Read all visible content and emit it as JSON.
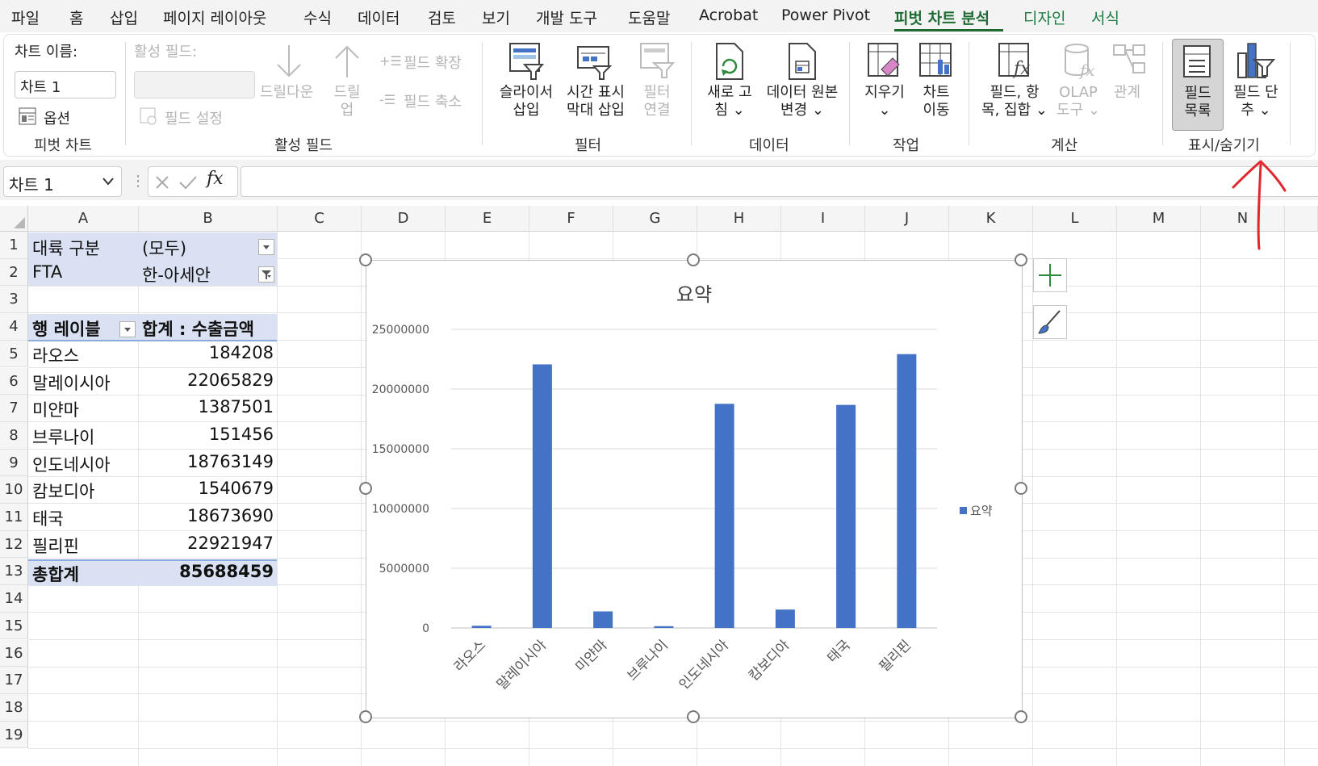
{
  "menu": {
    "tabs": [
      "파일",
      "홈",
      "삽입",
      "페이지 레이아웃",
      "수식",
      "데이터",
      "검토",
      "보기",
      "개발 도구",
      "도움말",
      "Acrobat",
      "Power Pivot",
      "피벗 차트 분석",
      "디자인",
      "서식"
    ],
    "active_tab": "피벗 차트 분석"
  },
  "ribbon": {
    "pivot_chart": {
      "chart_name_label": "차트 이름:",
      "chart_name_value": "차트 1",
      "options_label": "옵션",
      "group_label": "피벗 차트"
    },
    "active_field": {
      "field_label": "활성 필드:",
      "field_settings": "필드 설정",
      "drill_down": "드릴다운",
      "drill_up_1": "드릴",
      "drill_up_2": "업",
      "expand_field": "필드 확장",
      "collapse_field": "필드 축소",
      "group_label": "활성 필드"
    },
    "filter": {
      "slicer_1": "슬라이서",
      "slicer_2": "삽입",
      "timeline_1": "시간 표시",
      "timeline_2": "막대 삽입",
      "filter_conn_1": "필터",
      "filter_conn_2": "연결",
      "group_label": "필터"
    },
    "data": {
      "refresh_1": "새로 고",
      "refresh_2": "침",
      "change_source_1": "데이터 원본",
      "change_source_2": "변경",
      "group_label": "데이터"
    },
    "actions": {
      "clear": "지우기",
      "move_1": "차트",
      "move_2": "이동",
      "group_label": "작업"
    },
    "calculations": {
      "fields_1": "필드, 항",
      "fields_2": "목, 집합",
      "olap_1": "OLAP",
      "olap_2": "도구",
      "relations": "관계",
      "group_label": "계산"
    },
    "show_hide": {
      "field_list_1": "필드",
      "field_list_2": "목록",
      "field_buttons_1": "필드 단",
      "field_buttons_2": "추",
      "group_label": "표시/숨기기"
    }
  },
  "formula_bar": {
    "name_box": "차트 1",
    "fx": "fx",
    "value": ""
  },
  "sheet": {
    "columns": [
      "A",
      "B",
      "C",
      "D",
      "E",
      "F",
      "G",
      "H",
      "I",
      "J",
      "K",
      "L",
      "M",
      "N"
    ],
    "rows": [
      "1",
      "2",
      "3",
      "4",
      "5",
      "6",
      "7",
      "8",
      "9",
      "10",
      "11",
      "12",
      "13",
      "14",
      "15",
      "16",
      "17",
      "18",
      "19"
    ],
    "pivot": {
      "filter1_label": "대륙 구분",
      "filter1_value": "(모두)",
      "filter2_label": "FTA",
      "filter2_value": "한-아세안",
      "row_label_header": "행 레이블",
      "value_header": "합계 : 수출금액",
      "items": [
        {
          "label": "라오스",
          "value": "184208"
        },
        {
          "label": "말레이시아",
          "value": "22065829"
        },
        {
          "label": "미얀마",
          "value": "1387501"
        },
        {
          "label": "브루나이",
          "value": "151456"
        },
        {
          "label": "인도네시아",
          "value": "18763149"
        },
        {
          "label": "캄보디아",
          "value": "1540679"
        },
        {
          "label": "태국",
          "value": "18673690"
        },
        {
          "label": "필리핀",
          "value": "22921947"
        }
      ],
      "total_label": "총합계",
      "total_value": "85688459"
    }
  },
  "chart_data": {
    "type": "bar",
    "title": "요약",
    "categories": [
      "라오스",
      "말레이시아",
      "미얀마",
      "브루나이",
      "인도네시아",
      "캄보디아",
      "태국",
      "필리핀"
    ],
    "series": [
      {
        "name": "요약",
        "values": [
          184208,
          22065829,
          1387501,
          151456,
          18763149,
          1540679,
          18673690,
          22921947
        ],
        "color": "#4472c4"
      }
    ],
    "ylim": [
      0,
      25000000
    ],
    "yticks": [
      "0",
      "5000000",
      "10000000",
      "15000000",
      "20000000",
      "25000000"
    ],
    "grid": true,
    "legend": "right"
  },
  "colors": {
    "accent": "#1e6b34",
    "pivot_band": "#d9e1f2",
    "bar": "#4472c4",
    "annotation": "#e0282e"
  }
}
